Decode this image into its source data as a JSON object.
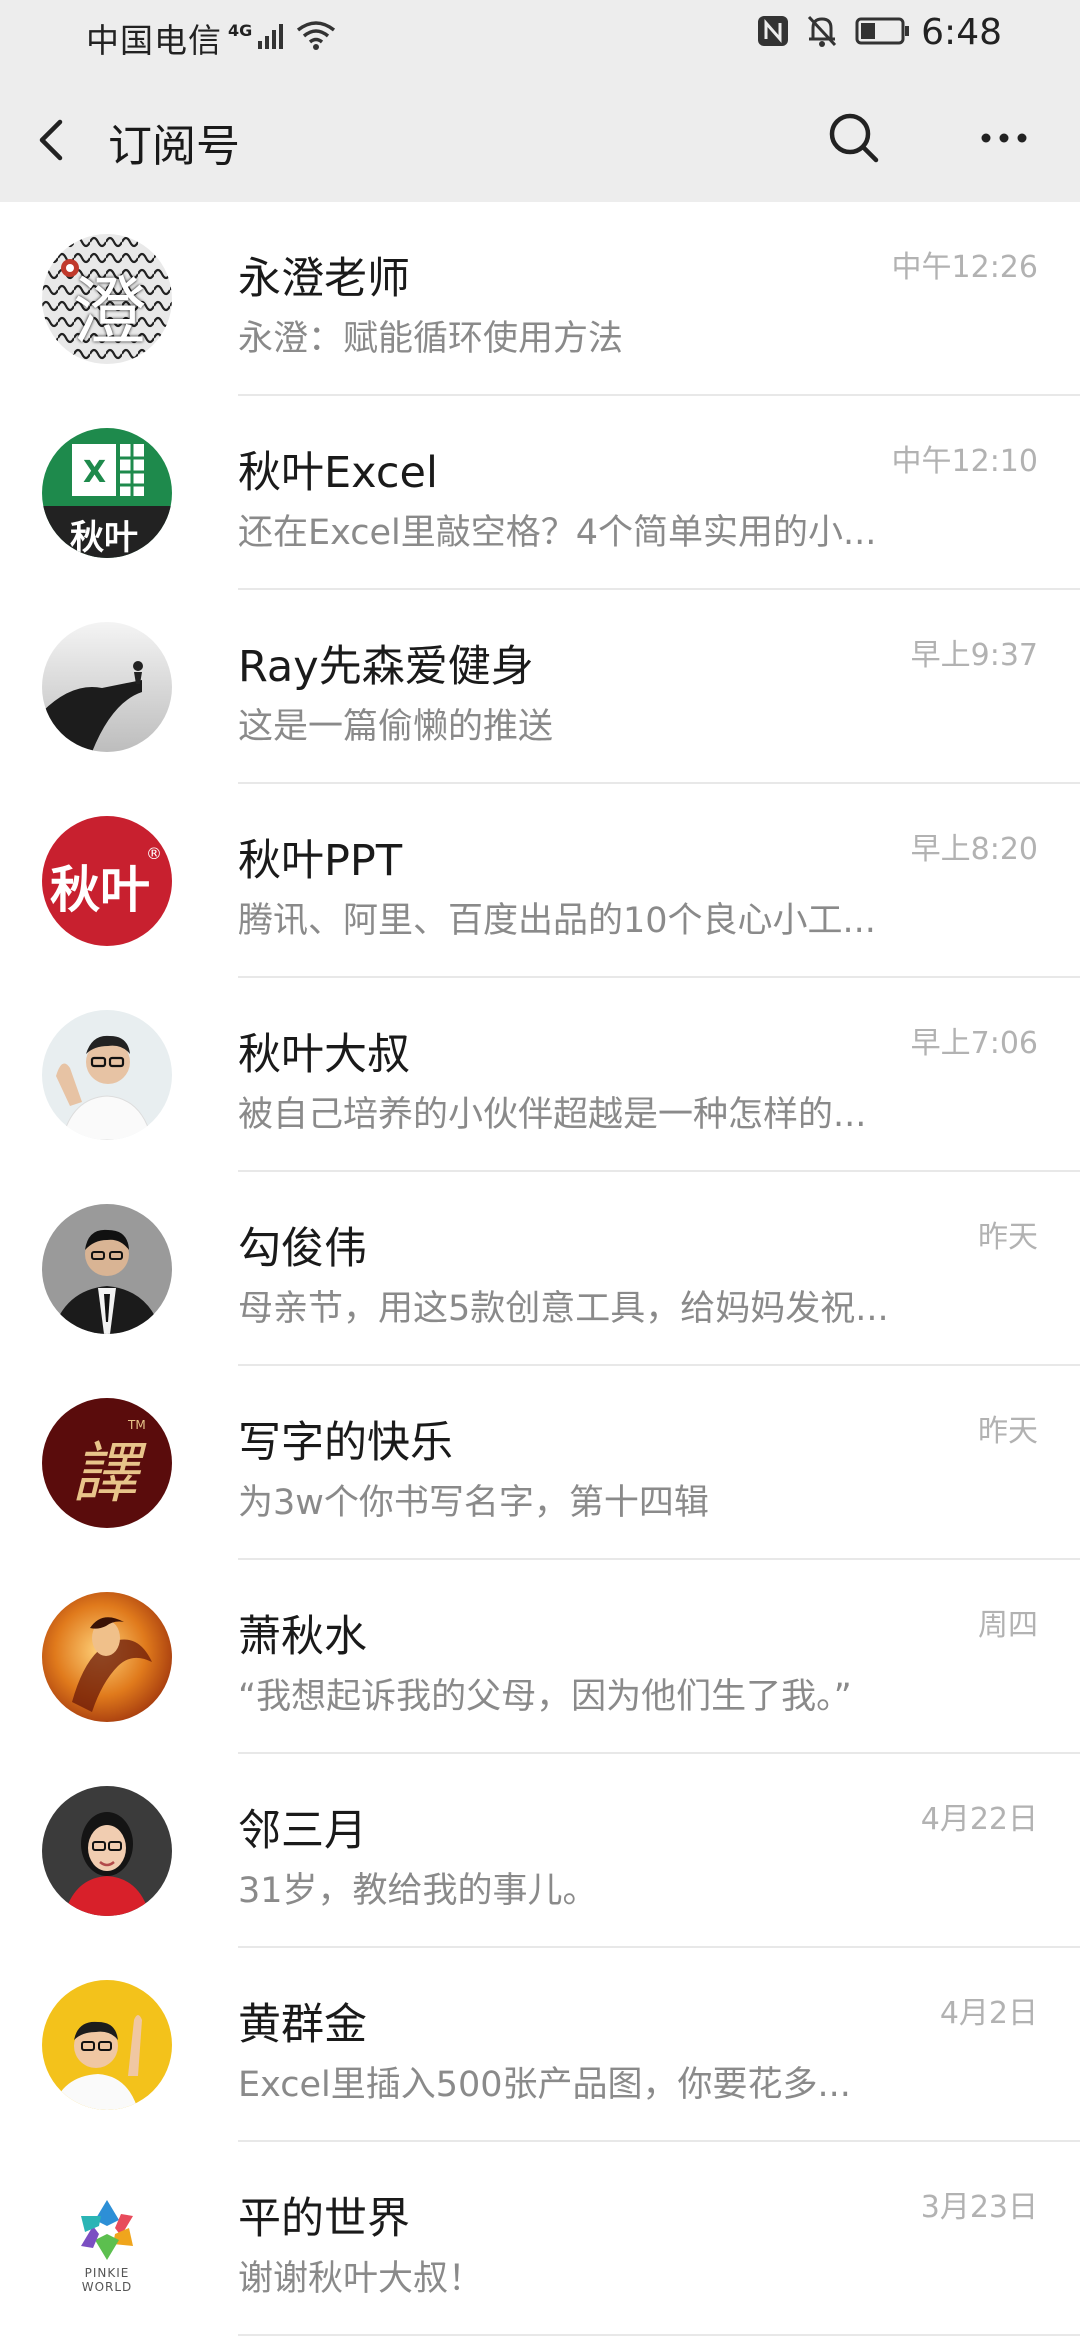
{
  "status_bar": {
    "carrier": "中国电信",
    "network": "4G",
    "time": "6:48"
  },
  "nav": {
    "title": "订阅号"
  },
  "accounts": [
    {
      "name": "永澄老师",
      "preview": "永澄：赋能循环使用方法",
      "time": "中午12:26",
      "avatar_text": "澄"
    },
    {
      "name": "秋叶Excel",
      "preview": "还在Excel里敲空格？4个简单实用的小...",
      "time": "中午12:10",
      "avatar_text": "秋叶"
    },
    {
      "name": "Ray先森爱健身",
      "preview": "这是一篇偷懒的推送",
      "time": "早上9:37"
    },
    {
      "name": "秋叶PPT",
      "preview": "腾讯、阿里、百度出品的10个良心小工...",
      "time": "早上8:20",
      "avatar_text": "秋叶"
    },
    {
      "name": "秋叶大叔",
      "preview": "被自己培养的小伙伴超越是一种怎样的...",
      "time": "早上7:06"
    },
    {
      "name": "勾俊伟",
      "preview": "母亲节，用这5款创意工具，给妈妈发祝...",
      "time": "昨天"
    },
    {
      "name": "写字的快乐",
      "preview": "为3w个你书写名字，第十四辑",
      "time": "昨天",
      "avatar_text": "譯"
    },
    {
      "name": "萧秋水",
      "preview": "“我想起诉我的父母，因为他们生了我。”",
      "time": "周四"
    },
    {
      "name": "邻三月",
      "preview": "31岁，教给我的事儿。",
      "time": "4月22日"
    },
    {
      "name": "黄群金",
      "preview": "Excel里插入500张产品图，你要花多...",
      "time": "4月2日"
    },
    {
      "name": "平的世界",
      "preview": "谢谢秋叶大叔！",
      "time": "3月23日",
      "avatar_text": "PINKIE WORLD"
    }
  ]
}
